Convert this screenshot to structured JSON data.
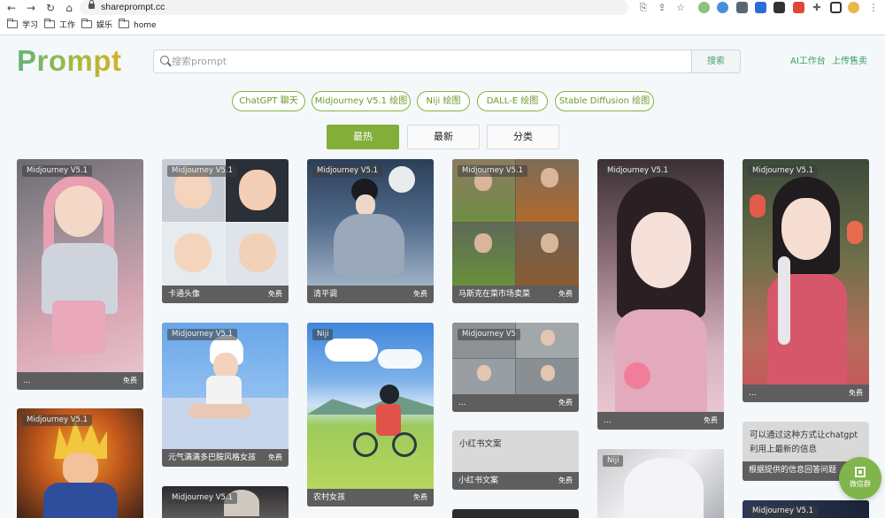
{
  "browser": {
    "url": "shareprompt.cc",
    "bookmarks": [
      "学习",
      "工作",
      "娱乐",
      "home"
    ]
  },
  "site": {
    "logo": "Prompt",
    "search": {
      "placeholder": "搜索prompt",
      "button": "搜索"
    },
    "links": [
      "AI工作台",
      "上传售卖"
    ],
    "categories": [
      "ChatGPT 聊天",
      "Midjourney V5.1 绘图",
      "Niji 绘图",
      "DALL-E 绘图",
      "Stable Diffusion 绘图"
    ],
    "sort_tabs": [
      "最热",
      "最新",
      "分类"
    ],
    "active_sort": "最热"
  },
  "cards": [
    {
      "tag": "Midjourney V5.1",
      "title": "...",
      "price": "免费"
    },
    {
      "tag": "Midjourney V5.1",
      "title": "卡通头像",
      "price": "免费"
    },
    {
      "tag": "Midjourney V5.1",
      "title": "清平调",
      "price": "免费"
    },
    {
      "tag": "Midjourney V5.1",
      "title": "马斯克在菜市场卖菜",
      "price": "免费"
    },
    {
      "tag": "Midjourney V5.1",
      "title": "...",
      "price": "免费"
    },
    {
      "tag": "Midjourney V5.1",
      "title": "...",
      "price": "免费"
    },
    {
      "tag": "Midjourney V5.1",
      "title": "元气满满多巴胺风格女孩",
      "price": "免费"
    },
    {
      "tag": "Niji",
      "title": "农村女孩",
      "price": "免费"
    },
    {
      "tag": "Midjourney V5",
      "title": "...",
      "price": "免费"
    },
    {
      "tag": "",
      "title": "小红书文案",
      "price": "免费",
      "body": "小红书文案"
    },
    {
      "tag": "",
      "title": "根据提供的信息回答问题",
      "price": "",
      "body": "可以通过这种方式让chatgpt利用上最新的信息"
    },
    {
      "tag": "Midjourney V5.1",
      "title": "",
      "price": ""
    },
    {
      "tag": "Midjourney V5.1",
      "title": "",
      "price": ""
    },
    {
      "tag": "Niji",
      "title": "",
      "price": ""
    },
    {
      "tag": "Midjourney V5.1",
      "title": "",
      "price": ""
    }
  ],
  "fab": {
    "label": "微信群"
  },
  "colors": {
    "accent": "#83ae3a",
    "link": "#3c9e60",
    "card_footer": "#5e5e5e"
  }
}
